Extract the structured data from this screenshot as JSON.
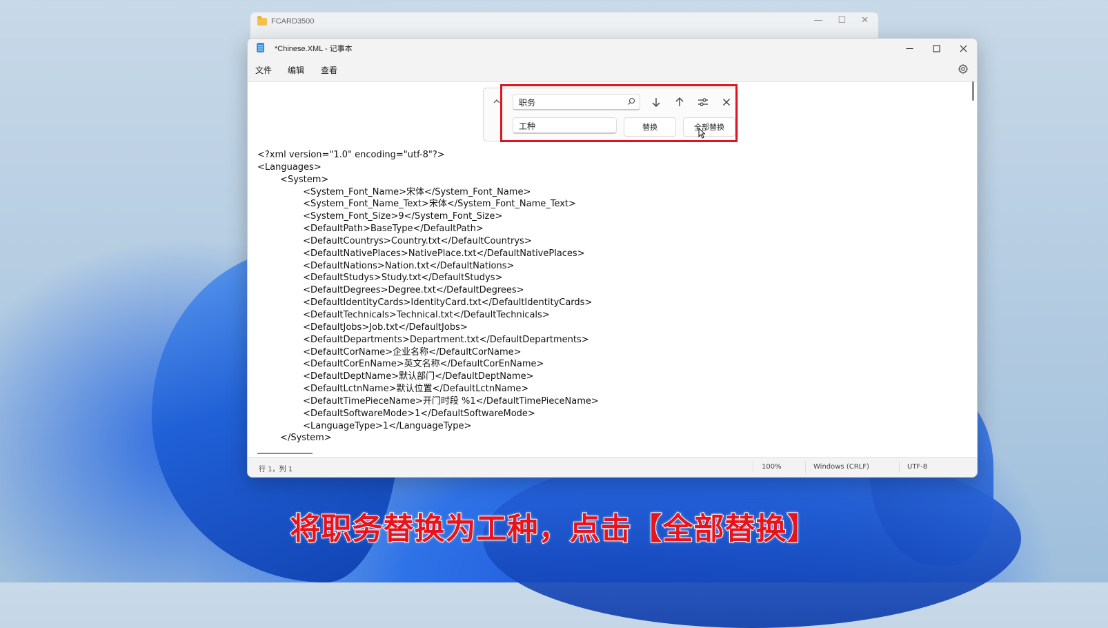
{
  "back_window": {
    "title": "FCARD3500"
  },
  "notepad": {
    "title": "*Chinese.XML - 记事本",
    "menu": [
      "文件",
      "编辑",
      "查看"
    ],
    "find_panel": {
      "find_value": "职务",
      "replace_value": "工种",
      "replace_label": "替换",
      "replace_all_label": "全部替换"
    },
    "lines": [
      "<?xml version=\"1.0\" encoding=\"utf-8\"?>",
      "<Languages>",
      "        <System>",
      "                <System_Font_Name>宋体</System_Font_Name>",
      "                <System_Font_Name_Text>宋体</System_Font_Name_Text>",
      "                <System_Font_Size>9</System_Font_Size>",
      "                <DefaultPath>BaseType</DefaultPath>",
      "                <DefaultCountrys>Country.txt</DefaultCountrys>",
      "                <DefaultNativePlaces>NativePlace.txt</DefaultNativePlaces>",
      "                <DefaultNations>Nation.txt</DefaultNations>",
      "                <DefaultStudys>Study.txt</DefaultStudys>",
      "                <DefaultDegrees>Degree.txt</DefaultDegrees>",
      "                <DefaultIdentityCards>IdentityCard.txt</DefaultIdentityCards>",
      "                <DefaultTechnicals>Technical.txt</DefaultTechnicals>",
      "                <DefaultJobs>Job.txt</DefaultJobs>",
      "                <DefaultDepartments>Department.txt</DefaultDepartments>",
      "                <DefaultCorName>企业名称</DefaultCorName>",
      "                <DefaultCorEnName>英文名称</DefaultCorEnName>",
      "                <DefaultDeptName>默认部门</DefaultDeptName>",
      "                <DefaultLctnName>默认位置</DefaultLctnName>",
      "                <DefaultTimePieceName>开门时段 %1</DefaultTimePieceName>",
      "                <DefaultSoftwareMode>1</DefaultSoftwareMode>",
      "                <LanguageType>1</LanguageType>",
      "        </System>"
    ],
    "status": {
      "position": "行 1，列 1",
      "zoom": "100%",
      "line_ending": "Windows (CRLF)",
      "encoding": "UTF-8"
    }
  },
  "subtitle": "将职务替换为工种，点击【全部替换】"
}
